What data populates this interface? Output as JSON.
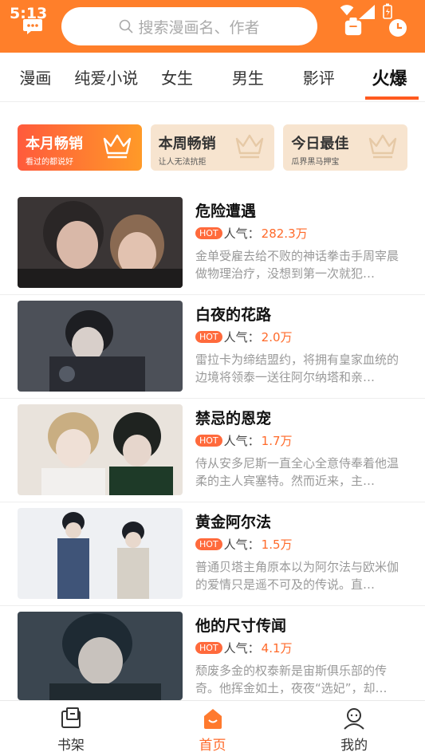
{
  "status": {
    "time": "5:13"
  },
  "search": {
    "placeholder": "搜索漫画名、作者"
  },
  "tabs": [
    {
      "label": "漫画",
      "active": false
    },
    {
      "label": "纯爱小说",
      "active": false
    },
    {
      "label": "女生",
      "active": false
    },
    {
      "label": "男生",
      "active": false
    },
    {
      "label": "影评",
      "active": false
    },
    {
      "label": "火爆",
      "active": true
    }
  ],
  "rankings": [
    {
      "title": "本月畅销",
      "subtitle": "看过的都说好",
      "active": true
    },
    {
      "title": "本周畅销",
      "subtitle": "让人无法抗拒",
      "active": false
    },
    {
      "title": "今日最佳",
      "subtitle": "瓜界黑马押宝",
      "active": false
    }
  ],
  "comics": [
    {
      "title": "危险遭遇",
      "hot": "HOT",
      "pop_label": "人气：",
      "pop_value": "282.3万",
      "desc": "金单受雇去给不败的神话拳击手周宰晨做物理治疗，没想到第一次就犯…"
    },
    {
      "title": "白夜的花路",
      "hot": "HOT",
      "pop_label": "人气：",
      "pop_value": "2.0万",
      "desc": "雷拉卡为缔结盟约，将拥有皇家血统的边境将领泰一送往阿尔纳塔和亲…"
    },
    {
      "title": "禁忌的恩宠",
      "hot": "HOT",
      "pop_label": "人气：",
      "pop_value": "1.7万",
      "desc": "侍从安多尼斯一直全心全意侍奉着他温柔的主人宾塞特。然而近来，主…"
    },
    {
      "title": "黄金阿尔法",
      "hot": "HOT",
      "pop_label": "人气：",
      "pop_value": "1.5万",
      "desc": "普通贝塔主角原本以为阿尔法与欧米伽的爱情只是遥不可及的传说。直…"
    },
    {
      "title": "他的尺寸传闻",
      "hot": "HOT",
      "pop_label": "人气：",
      "pop_value": "4.1万",
      "desc": "颓废多金的权泰新是宙斯俱乐部的传奇。他挥金如土，夜夜“选妃”，却…"
    }
  ],
  "nav": [
    {
      "label": "书架",
      "icon": "bookshelf-icon",
      "active": false
    },
    {
      "label": "首页",
      "icon": "home-icon",
      "active": true
    },
    {
      "label": "我的",
      "icon": "profile-icon",
      "active": false
    }
  ],
  "colors": {
    "accent": "#ff7f2a",
    "hot": "#ff6a3c",
    "rank_bg": "#f7e4cf"
  }
}
